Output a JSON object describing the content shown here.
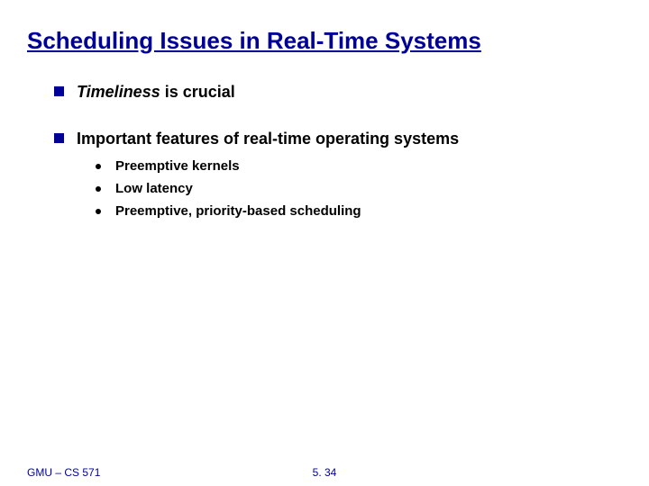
{
  "title": "Scheduling Issues in Real-Time  Systems",
  "bullets": {
    "b1_italic": "Timeliness",
    "b1_rest": " is crucial",
    "b2": "Important features of real-time operating systems"
  },
  "subs": {
    "s1": "Preemptive kernels",
    "s2": "Low latency",
    "s3": "Preemptive, priority-based scheduling"
  },
  "footer": {
    "left": "GMU – CS 571",
    "center": "5. 34"
  }
}
